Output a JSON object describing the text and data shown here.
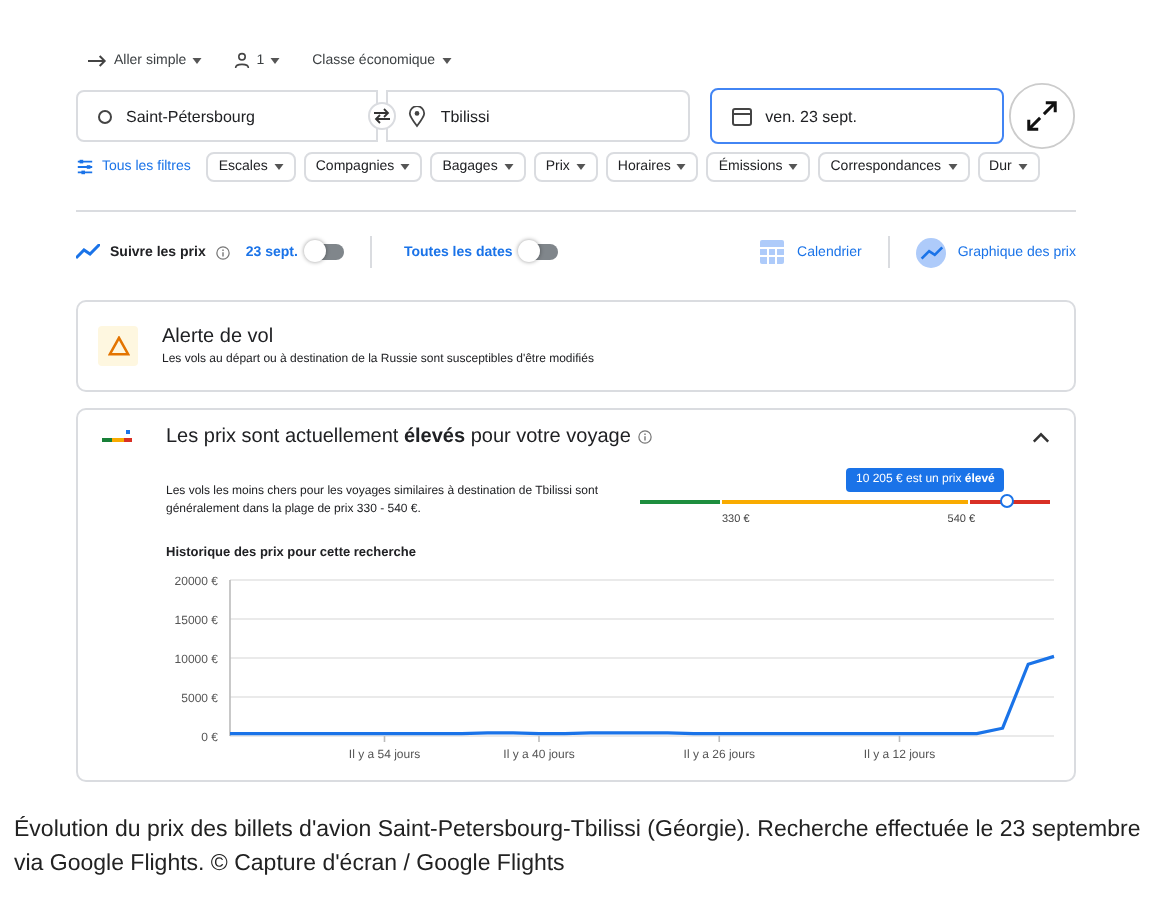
{
  "trip_options": [
    {
      "kind": "trip",
      "label": "Aller simple"
    },
    {
      "kind": "passengers",
      "label": "1"
    },
    {
      "kind": "class",
      "label": "Classe économique"
    }
  ],
  "search": {
    "origin": "Saint-Pétersbourg",
    "destination": "Tbilissi",
    "date": "ven. 23 sept."
  },
  "all_filters": "Tous les filtres",
  "filters": [
    "Escales",
    "Compagnies",
    "Bagages",
    "Prix",
    "Horaires",
    "Émissions",
    "Correspondances",
    "Dur"
  ],
  "tracking": {
    "label": "Suivre les prix",
    "toggles": [
      {
        "label": "23 sept.",
        "on": false
      },
      {
        "label": "Toutes les dates",
        "on": false
      }
    ]
  },
  "views": [
    {
      "kind": "calendar",
      "label": "Calendrier"
    },
    {
      "kind": "graph",
      "label": "Graphique des prix"
    }
  ],
  "alert": {
    "title": "Alerte de vol",
    "message": "Les vols au départ ou à destination de la Russie sont susceptibles d'être modifiés"
  },
  "insights": {
    "heading": "Les prix sont actuellement **élevés** pour votre voyage",
    "expanded": true,
    "summary": "Les vols les moins chers pour les voyages similaires à destination de Tbilissi sont généralement dans la plage de prix 330 - 540 €.",
    "range_labels": [
      "330 €",
      "540 €"
    ],
    "tooltip": "10 205 € est un prix **élevé**",
    "history_title": "Historique des prix pour cette recherche",
    "chart_data": {
      "type": "line",
      "categories": [
        null,
        null,
        null,
        null,
        null,
        null,
        "Il y a 54 jours",
        null,
        null,
        null,
        null,
        null,
        "Il y a 40 jours",
        null,
        null,
        null,
        null,
        null,
        null,
        "Il y a 26 jours",
        null,
        null,
        null,
        null,
        null,
        null,
        "Il y a 12 jours",
        null,
        null,
        null,
        null,
        null,
        null
      ],
      "series": [
        {
          "color": "#1a73e8",
          "values": [
            300,
            300,
            300,
            300,
            300,
            300,
            300,
            300,
            300,
            300,
            400,
            400,
            300,
            300,
            400,
            400,
            400,
            400,
            300,
            300,
            300,
            300,
            300,
            300,
            300,
            300,
            300,
            300,
            300,
            300,
            1000,
            9200,
            10200
          ]
        }
      ],
      "ylim": [
        0,
        20000
      ],
      "grid": true,
      "yticks": [
        {
          "value": 0,
          "label": "0 €"
        },
        {
          "value": 5000,
          "label": "5000 €"
        },
        {
          "value": 10000,
          "label": "10000 €"
        },
        {
          "value": 15000,
          "label": "15000 €"
        },
        {
          "value": 20000,
          "label": "20000 €"
        }
      ]
    }
  },
  "caption": "Évolution du prix des billets d'avion Saint-Petersbourg-Tbilissi (Géorgie). Recherche effectuée le 23 septembre via Google Flights. © Capture d'écran / Google Flights"
}
